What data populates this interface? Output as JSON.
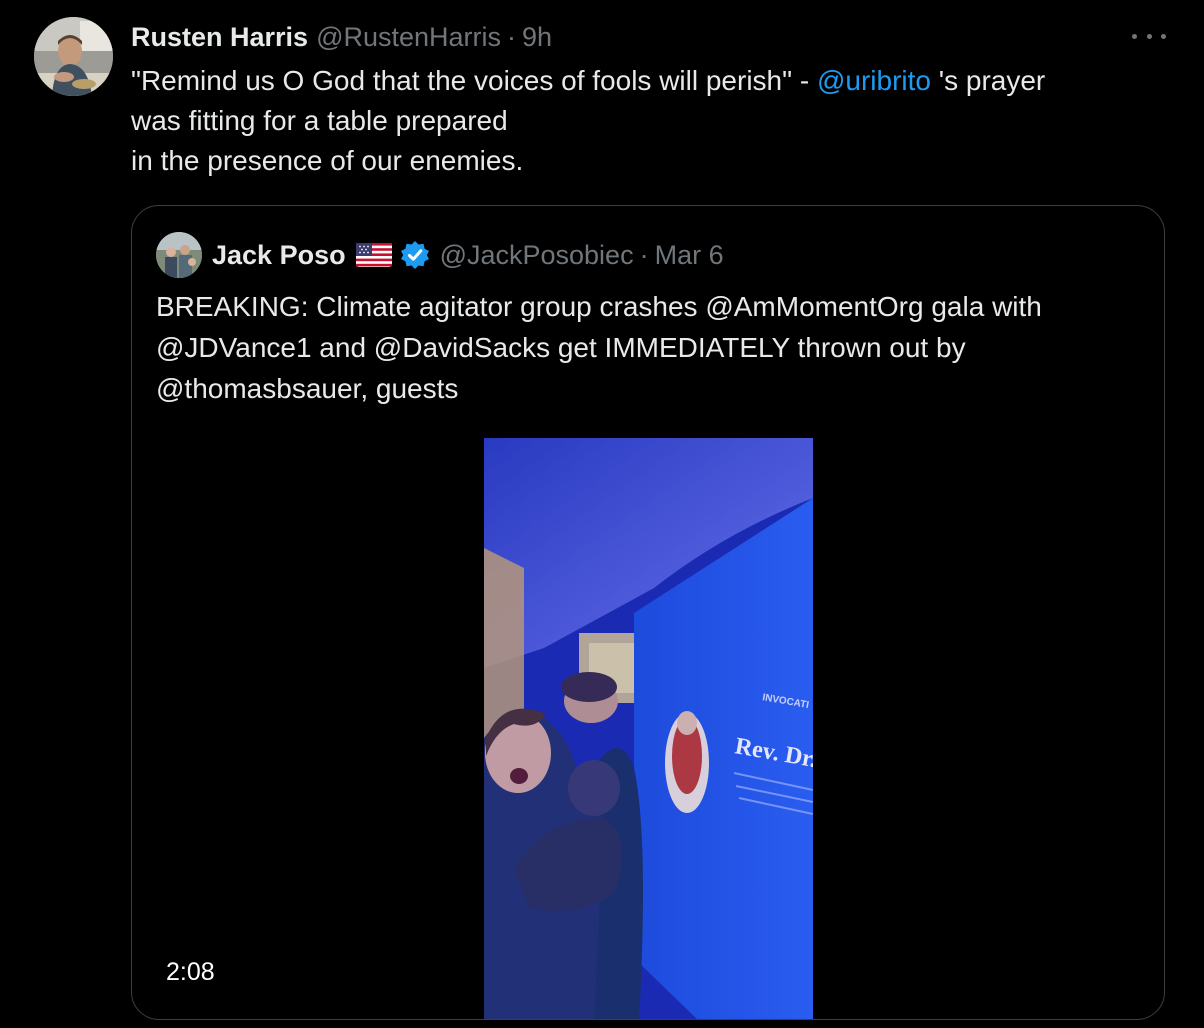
{
  "tweet": {
    "author_name": "Rusten Harris",
    "author_handle": "@RustenHarris",
    "separator": "·",
    "time": "9h",
    "more_icon": "more-horizontal-icon",
    "text_part1": "\"Remind us O God that the voices of fools will perish\" - ",
    "mention": "@uribrito",
    "text_part2": " 's prayer",
    "text_line2": "was fitting for a table prepared",
    "text_line3": "in the presence of our enemies."
  },
  "quote": {
    "author_name": "Jack Poso",
    "flag_icon": "us-flag-icon",
    "verified_icon": "verified-badge-icon",
    "author_handle": "@JackPosobiec",
    "separator": "·",
    "time": "Mar 6",
    "text_line1": "BREAKING: Climate agitator group crashes @AmMomentOrg gala with",
    "text_line2": "@JDVance1 and @DavidSacks get IMMEDIATELY thrown out by",
    "text_line3": "@thomasbsauer, guests",
    "video": {
      "duration": "2:08",
      "banner_small": "INVOCATI",
      "banner_title": "Rev. Dr. U"
    }
  },
  "colors": {
    "background": "#000000",
    "text": "#e7e9ea",
    "secondary": "#71767b",
    "link": "#1d9bf0",
    "border": "#3a3f44"
  }
}
